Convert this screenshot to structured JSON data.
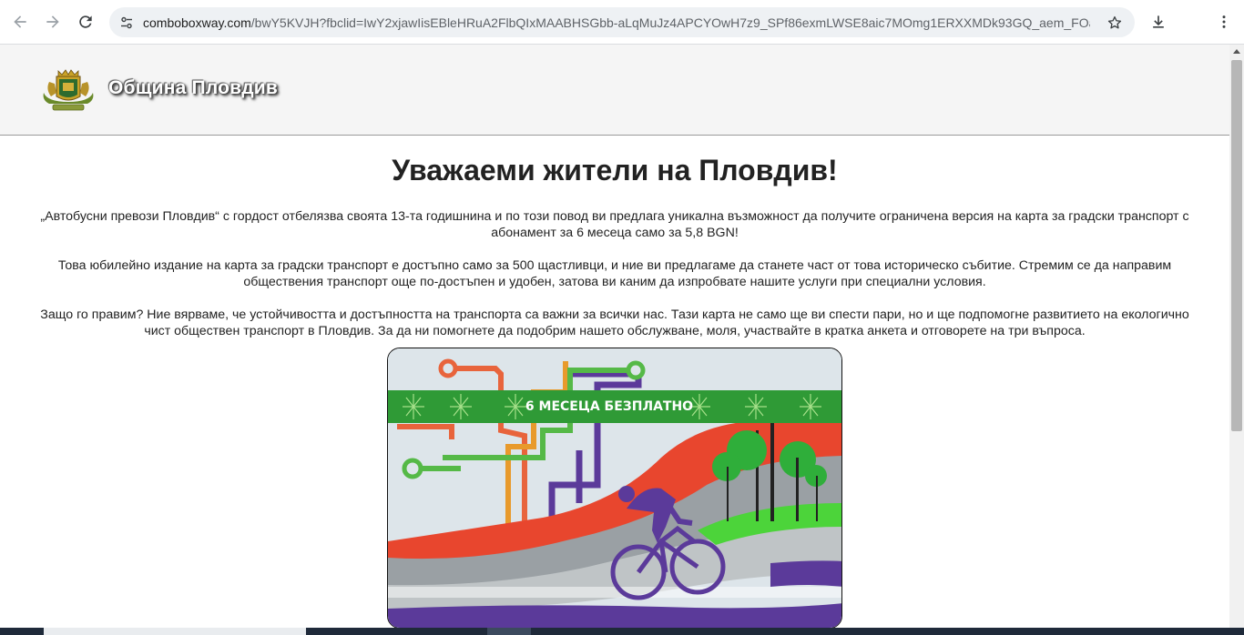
{
  "browser": {
    "url_host": "comboboxway.com",
    "url_path": "/bwY5KVJH?fbclid=IwY2xjawIisEBleHRuA2FlbQIxMAABHSGbb-aLqMuJz4APCYOwH7z9_SPf86exmLWSE8aic7MOmg1ERXXMDk93GQ_aem_FOadIzJH-...",
    "icons": [
      "back-arrow-icon",
      "forward-arrow-icon",
      "reload-icon",
      "site-info-icon",
      "star-icon",
      "download-icon",
      "more-vert-icon"
    ]
  },
  "site": {
    "title": "Община Пловдив"
  },
  "main": {
    "heading": "Уважаеми жители на Пловдив!",
    "paragraphs": [
      "„Автобусни превози Пловдив“ с гордост отбелязва своята 13-та годишнина и по този повод ви предлага уникална възможност да получите ограничена версия на карта за градски транспорт с абонамент за 6 месеца само за 5,8 BGN!",
      "Това юбилейно издание на карта за градски транспорт е достъпно само за 500 щастливци, и ние ви предлагаме да станете част от това историческо събитие. Стремим се да направим обществения транспорт още по-достъпен и удобен, затова ви каним да изпробвате нашите услуги при специални условия.",
      "Защо го правим? Ние вярваме, че устойчивостта и достъпността на транспорта са важни за всички нас. Тази карта не само ще ви спести пари, но и ще подпомогне развитието на екологично чист обществен транспорт в Пловдив. За да ни помогнете да подобрим нашето обслужване, моля, участвайте в кратка анкета и отговорете на три въпроса."
    ],
    "card": {
      "banner_text": "6 МЕСЕЦА БЕЗПЛАТНО"
    }
  },
  "colors": {
    "banner_green": "#2f9a36",
    "line_orange": "#e8643c",
    "line_green": "#55b947",
    "line_purple": "#5b3a9a",
    "wave_red": "#e8462e",
    "tree_green": "#2fae3a"
  }
}
